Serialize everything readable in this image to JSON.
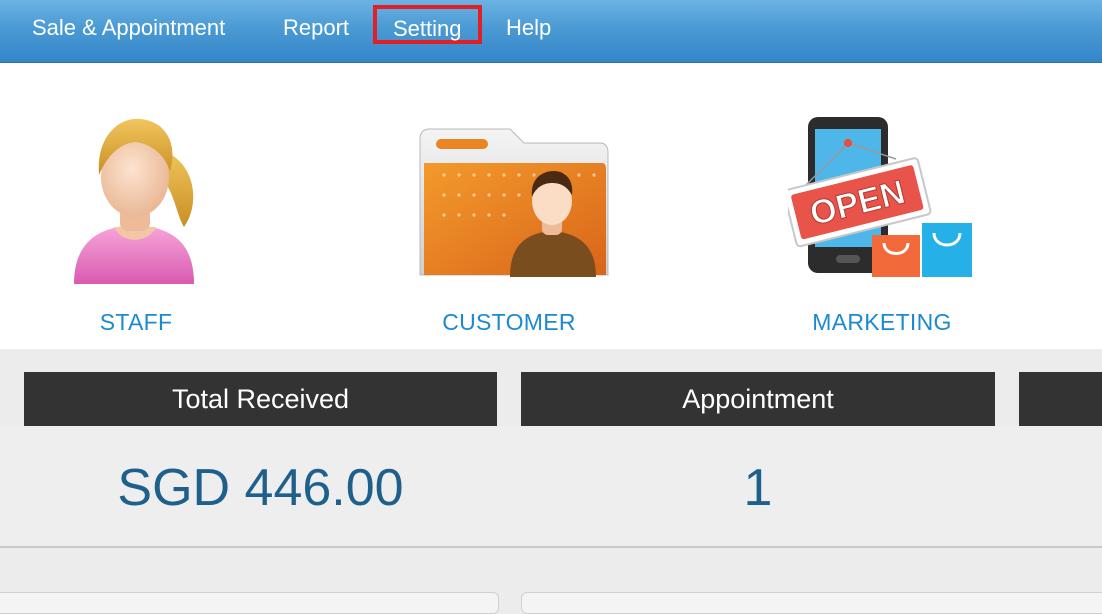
{
  "nav": {
    "items": [
      {
        "label": "Sale & Appointment"
      },
      {
        "label": "Report"
      },
      {
        "label": "Setting"
      },
      {
        "label": "Help"
      }
    ],
    "highlight_color": "#e01f26",
    "bar_color": "#4a9ad4"
  },
  "tiles": [
    {
      "label": "STAFF",
      "icon": "staff-icon"
    },
    {
      "label": "CUSTOMER",
      "icon": "customer-folder-icon"
    },
    {
      "label": "MARKETING",
      "icon": "marketing-open-sign-icon"
    }
  ],
  "sign_text": "OPEN",
  "stats": [
    {
      "header": "Total Received",
      "value": "SGD 446.00"
    },
    {
      "header": "Appointment",
      "value": "1"
    },
    {
      "header": "",
      "value": ""
    }
  ],
  "colors": {
    "label_blue": "#1c8ad0",
    "value_blue": "#1f5f8b",
    "header_bg": "#333333"
  }
}
